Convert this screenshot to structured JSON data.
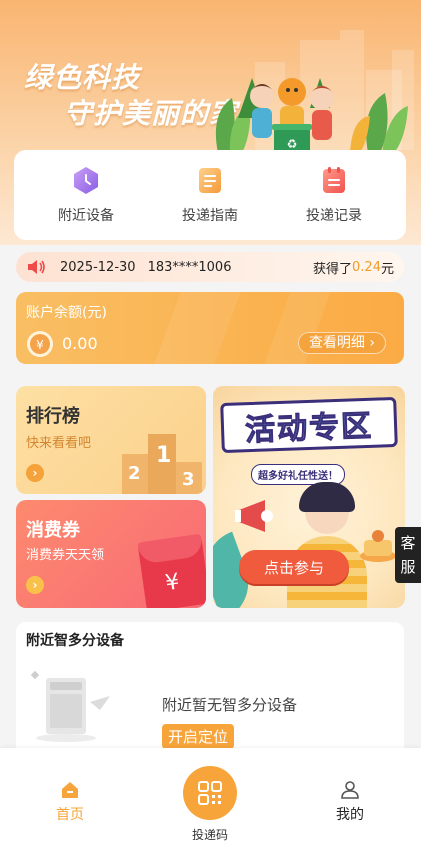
{
  "banner": {
    "line1": "绿色科技",
    "line2": "守护美丽的家"
  },
  "quick_actions": [
    {
      "label": "附近设备",
      "icon": "hexagon-clock-icon"
    },
    {
      "label": "投递指南",
      "icon": "guide-document-icon"
    },
    {
      "label": "投递记录",
      "icon": "record-list-icon"
    }
  ],
  "notice": {
    "icon": "speaker-icon",
    "date": "2025-12-30",
    "phone": "183****1006",
    "prefix": "获得了",
    "amount": "0.24",
    "unit": "元"
  },
  "account": {
    "title": "账户余额(元)",
    "balance": "0.00",
    "detail_button": "查看明细",
    "coin_icon": "yuan-coin-icon"
  },
  "ranking": {
    "title": "排行榜",
    "subtitle": "快来看看吧",
    "podium": [
      "2",
      "1",
      "3"
    ]
  },
  "voucher": {
    "title": "消费券",
    "subtitle": "消费券天天领",
    "symbol": "¥"
  },
  "activity": {
    "title": "活动专区",
    "tagline": "超多好礼任性送！",
    "cta": "点击参与"
  },
  "customer_service": {
    "line1": "客",
    "line2": "服"
  },
  "nearby": {
    "title": "附近智多分设备",
    "empty_text": "附近暂无智多分设备",
    "locate_button": "开启定位"
  },
  "tabbar": {
    "home": "首页",
    "code": "投递码",
    "mine": "我的"
  },
  "colors": {
    "accent": "#f7a43a",
    "amount": "#f19b2c",
    "coupon": "#f86a76"
  }
}
